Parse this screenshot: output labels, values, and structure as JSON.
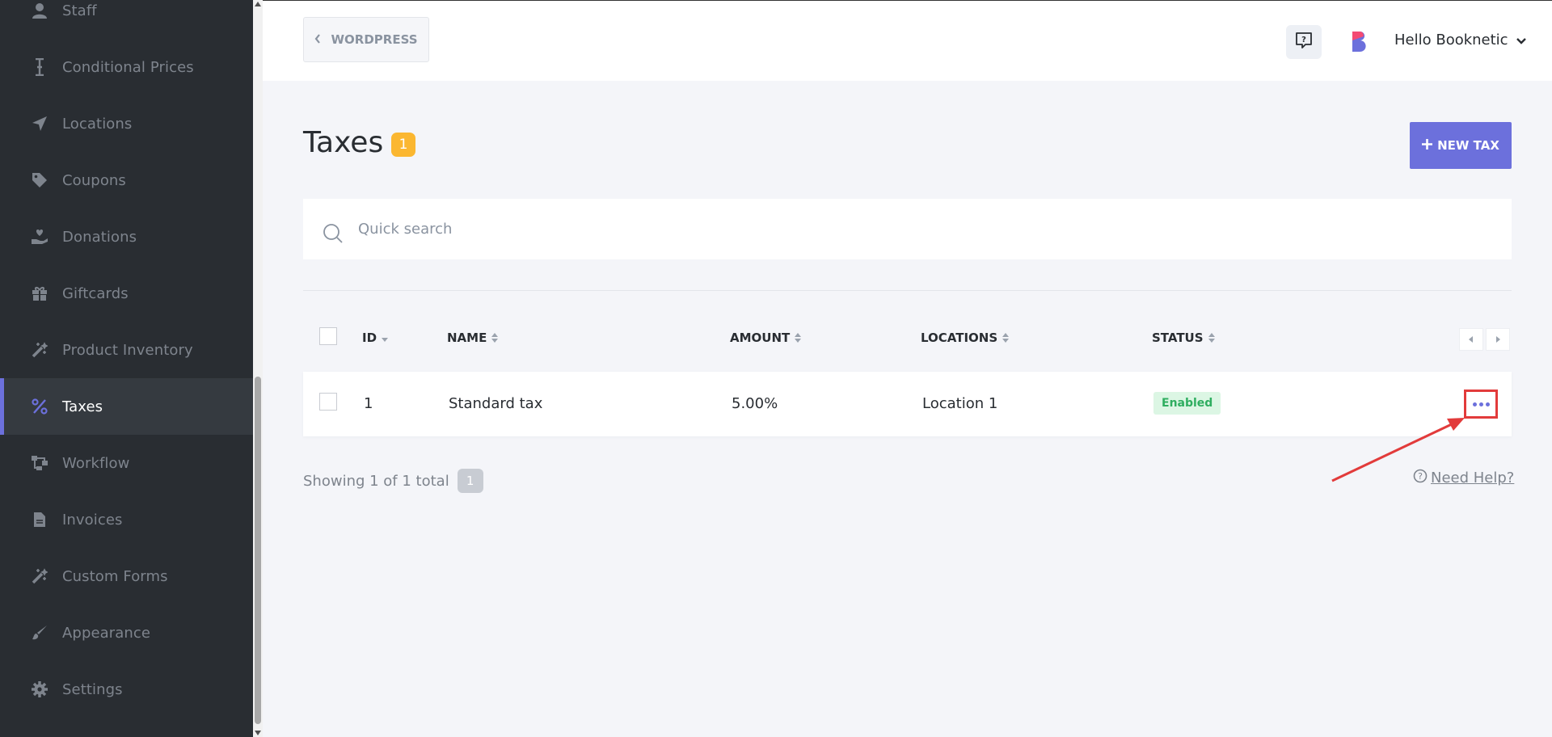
{
  "sidebar": {
    "items": [
      {
        "label": "Staff",
        "icon": "user-icon"
      },
      {
        "label": "Conditional Prices",
        "icon": "cursor-text-icon"
      },
      {
        "label": "Locations",
        "icon": "location-arrow-icon"
      },
      {
        "label": "Coupons",
        "icon": "tag-icon"
      },
      {
        "label": "Donations",
        "icon": "hand-holding-heart-icon"
      },
      {
        "label": "Giftcards",
        "icon": "gift-icon"
      },
      {
        "label": "Product Inventory",
        "icon": "magic-wand-icon"
      },
      {
        "label": "Taxes",
        "icon": "percent-icon"
      },
      {
        "label": "Workflow",
        "icon": "workflow-icon"
      },
      {
        "label": "Invoices",
        "icon": "file-icon"
      },
      {
        "label": "Custom Forms",
        "icon": "magic-wand-icon"
      },
      {
        "label": "Appearance",
        "icon": "brush-icon"
      },
      {
        "label": "Settings",
        "icon": "gear-icon"
      }
    ],
    "active": "Taxes"
  },
  "topbar": {
    "back_label": "WORDPRESS",
    "user_label": "Hello Booknetic"
  },
  "page": {
    "title": "Taxes",
    "count": "1",
    "new_button": "NEW TAX"
  },
  "search": {
    "placeholder": "Quick search"
  },
  "table": {
    "headers": {
      "id": "ID",
      "name": "NAME",
      "amount": "AMOUNT",
      "locations": "LOCATIONS",
      "status": "STATUS"
    },
    "rows": [
      {
        "id": "1",
        "name": "Standard tax",
        "amount": "5.00%",
        "location": "Location 1",
        "status": "Enabled"
      }
    ]
  },
  "footer": {
    "showing": "Showing 1 of 1 total",
    "count": "1",
    "help": "Need Help?"
  },
  "colors": {
    "sidebar_bg": "#292d32",
    "accent": "#6c70dc",
    "badge": "#fbb731",
    "status_green": "#2fae60",
    "annotation_red": "#e23b3b"
  }
}
